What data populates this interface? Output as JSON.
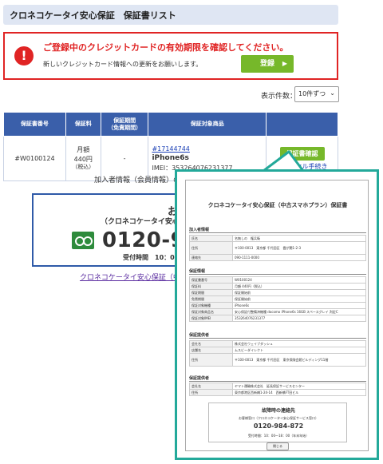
{
  "header": {
    "title": "クロネコケータイ安心保証　保証書リスト"
  },
  "alert": {
    "icon": "exclamation-circle-icon",
    "title": "ご登録中のクレジットカードの有効期限を確認してください。",
    "message": "新しいクレジットカード情報への更新をお願いします。",
    "button_label": "登録",
    "button_arrow": "▶"
  },
  "page_size": {
    "label": "表示件数：",
    "selected": "10件ずつ",
    "chevron": "⌄"
  },
  "table": {
    "headers": [
      "保証書番号",
      "保証料",
      "保証期間\n（免責期間）",
      "保証対象商品",
      ""
    ],
    "row": {
      "id": "#W0100124",
      "fee_period": "月額",
      "fee_amount": "440円",
      "fee_tax": "（税込）",
      "term": "-",
      "product_link": "#17144744",
      "product_name": "iPhone6s",
      "imei": "IMEI：353264076231377",
      "confirm_button": "保証書確認",
      "cancel_link": "キャンセル手続き"
    }
  },
  "member_info": "加入者情報（会員情報）の変更",
  "contact": {
    "title": "お客様お問合せ窓口",
    "subtitle": "（クロネコケータイ安心保証サービス窓口）",
    "logo": "freedial-icon",
    "phone": "0120-984-872",
    "hours": "受付時間　10：00～18：00"
  },
  "guarantee_link": "クロネコケータイ安心保証（中古スマホプラン）",
  "popup": {
    "title": "クロネコケータイ安心保証（中古スマホプラン）保証書",
    "sections": {
      "member": {
        "heading": "加入者情報",
        "rows": [
          {
            "k": "氏名",
            "v": "名無しの　権兵衛"
          },
          {
            "k": "住所",
            "v": "〒100-0013　東京都 千代田区　霞が関1-2-3"
          },
          {
            "k": "連絡先",
            "v": "090-1111-0000"
          }
        ]
      },
      "guarantee": {
        "heading": "保証情報",
        "rows": [
          {
            "k": "保証書番号",
            "v": "W0100124"
          },
          {
            "k": "保証料",
            "v": "月額 440円（税込）"
          },
          {
            "k": "保証期間",
            "v": "保証開始前"
          },
          {
            "k": "免責期間",
            "v": "保証開始前"
          },
          {
            "k": "保証対象機種",
            "v": "iPhone6s"
          },
          {
            "k": "保証対象商品名",
            "v": "安心保証付整備済機種 docomo iPhone6s 16GB スペースグレイ 判定C"
          },
          {
            "k": "保証対象IMEI",
            "v": "353264076231377"
          }
        ]
      },
      "provider": {
        "heading": "保証提供者",
        "rows": [
          {
            "k": "会社名",
            "v": "株式会社ウェイブダッシュ"
          },
          {
            "k": "店舗名",
            "v": "ムスビーダイレクト"
          },
          {
            "k": "住所",
            "v": "〒100-0013　東京都 千代田区　東京保険会館ビルディング11階"
          }
        ]
      },
      "operator": {
        "heading": "保証提供者",
        "rows": [
          {
            "k": "会社名",
            "v": "ヤマト運輸株式会社　延長保証サービスセンター"
          },
          {
            "k": "住所",
            "v": "東京都港区西新橋1-24-14　西新橋FT田ビル"
          }
        ]
      }
    },
    "contact": {
      "title": "故障時の連絡先",
      "subtitle": "お客様窓口（クロネコケータイ安心保証サービス窓口）",
      "phone": "0120-984-872",
      "hours": "受付時間：10：00～18：00（年末年始）"
    },
    "close_label": "閉じる"
  },
  "colors": {
    "header_bg": "#dfe6f3",
    "alert_red": "#e02424",
    "green": "#76b82a",
    "table_head": "#3a5faa",
    "popup_border": "#23a99a"
  }
}
